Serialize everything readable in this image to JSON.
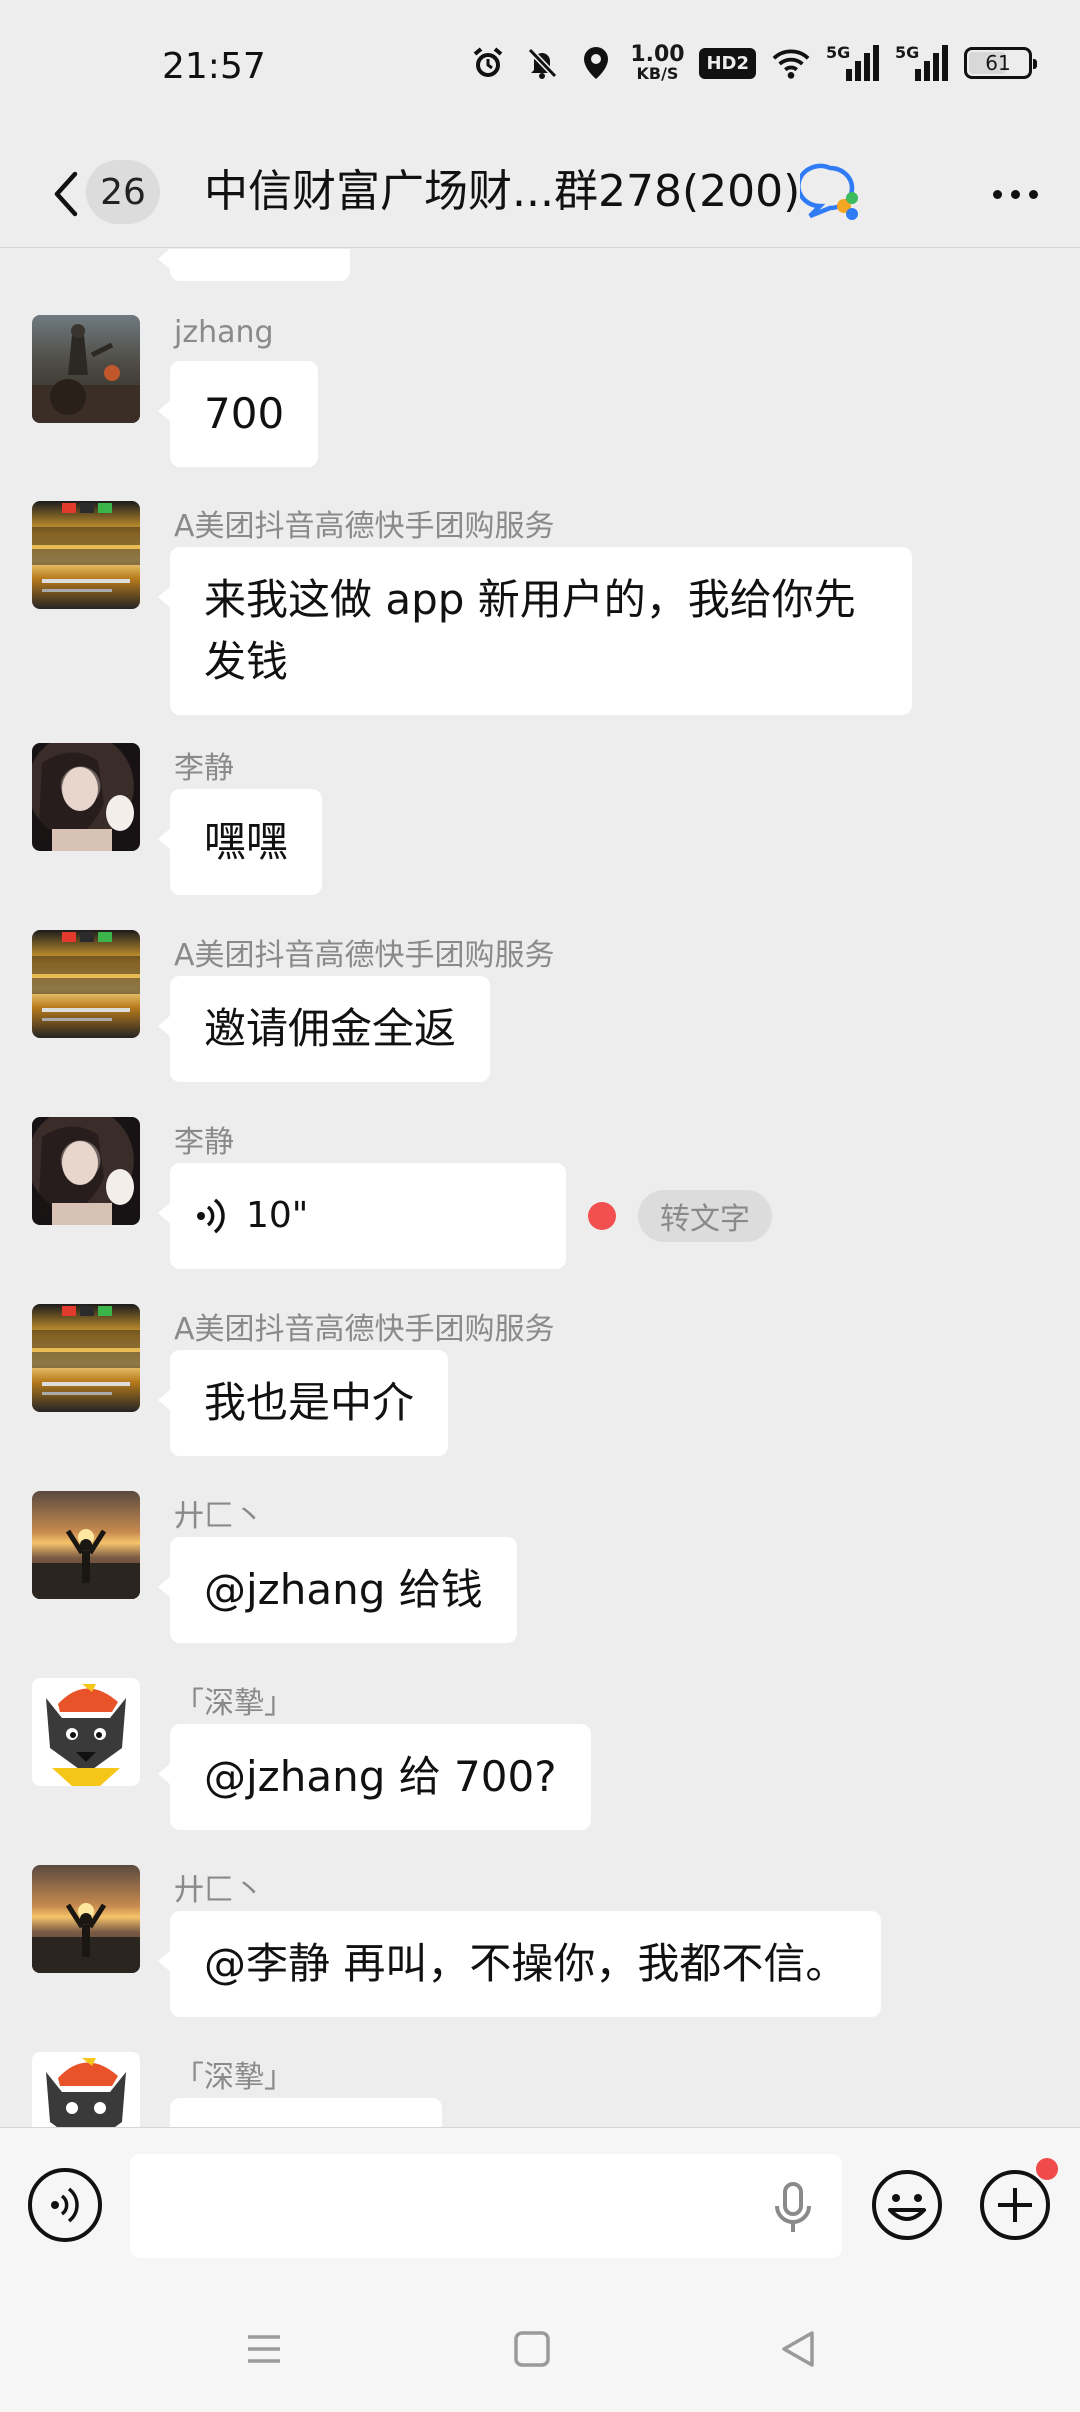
{
  "status_bar": {
    "time": "21:57",
    "net_speed_value": "1.00",
    "net_speed_unit": "KB/S",
    "hd_label": "HD2",
    "sim1_label": "5G",
    "sim2_label": "5G",
    "battery_level": "61"
  },
  "header": {
    "unread_count": "26",
    "title": "中信财富广场财...群278(200)"
  },
  "messages": [
    {
      "sender": "jzhang",
      "text": "700"
    },
    {
      "sender": "A美团抖音高德快手团购服务",
      "text_line1": "来我这做 app 新用户的，我给你先",
      "text_line2": "发钱"
    },
    {
      "sender": "李静",
      "text": "嘿嘿"
    },
    {
      "sender": "A美团抖音高德快手团购服务",
      "text": "邀请佣金全返"
    },
    {
      "sender": "李静",
      "voice_duration": "10\"",
      "to_text_label": "转文字"
    },
    {
      "sender": "A美团抖音高德快手团购服务",
      "text": "我也是中介"
    },
    {
      "sender": "廾匚丶",
      "text": "@jzhang  给钱"
    },
    {
      "sender": "「深摯」",
      "text": "@jzhang  给 700?"
    },
    {
      "sender": "廾匚丶",
      "text": "@李静  再叫，不操你，我都不信。"
    },
    {
      "sender": "「深摯」",
      "text": ""
    }
  ],
  "input": {
    "placeholder": ""
  },
  "colors": {
    "background": "#ededed",
    "bubble": "#ffffff",
    "unread_dot": "#f25050",
    "accent_blue": "#2f7cf6"
  }
}
